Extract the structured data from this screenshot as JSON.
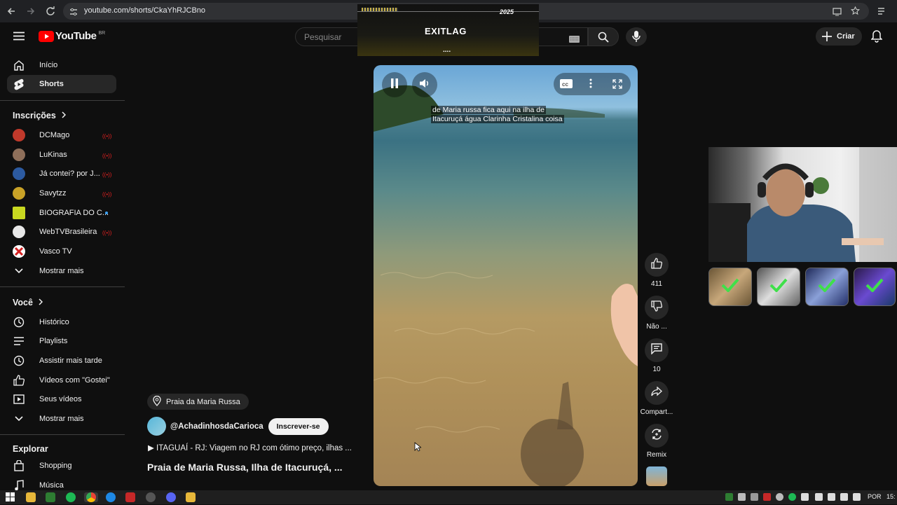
{
  "browser": {
    "url": "youtube.com/shorts/CkaYhRJCBno"
  },
  "header": {
    "logo_text": "YouTube",
    "region": "BR",
    "search_placeholder": "Pesquisar",
    "create_label": "Criar"
  },
  "ad_overlay": {
    "brand": "EXITLAG",
    "year": "2025",
    "dots": "...."
  },
  "sidebar": {
    "main": [
      {
        "label": "Início",
        "icon": "home-icon"
      },
      {
        "label": "Shorts",
        "icon": "shorts-icon"
      }
    ],
    "subscriptions_title": "Inscrições",
    "subscriptions": [
      {
        "label": "DCMago",
        "live": true,
        "color": "#c0392b"
      },
      {
        "label": "LuKinas",
        "live": true,
        "color": "#8e6f5a"
      },
      {
        "label": "Já contei? por J...",
        "live": true,
        "color": "#2c5aa0"
      },
      {
        "label": "Savytzz",
        "live": true,
        "color": "#c9a227"
      },
      {
        "label": "BIOGRAFIA DO C...",
        "live": false,
        "new": true,
        "color": "#c8d820"
      },
      {
        "label": "WebTVBrasileira",
        "live": true,
        "color": "#e8e8e8"
      },
      {
        "label": "Vasco TV",
        "live": false,
        "color": "#d42020"
      }
    ],
    "show_more_1": "Mostrar mais",
    "you_title": "Você",
    "you_items": [
      {
        "label": "Histórico",
        "icon": "history-icon"
      },
      {
        "label": "Playlists",
        "icon": "playlists-icon"
      },
      {
        "label": "Assistir mais tarde",
        "icon": "watch-later-icon"
      },
      {
        "label": "Vídeos com \"Gostei\"",
        "icon": "liked-icon"
      },
      {
        "label": "Seus vídeos",
        "icon": "your-videos-icon"
      }
    ],
    "show_more_2": "Mostrar mais",
    "explore_title": "Explorar",
    "explore_items": [
      {
        "label": "Shopping",
        "icon": "shopping-icon"
      },
      {
        "label": "Música",
        "icon": "music-icon"
      }
    ]
  },
  "video": {
    "caption_line1": "de Maria russa fica aqui na ilha de",
    "caption_line2": "Itacuruçá água Clarinha Cristalina coisa",
    "location": "Praia da Maria Russa",
    "channel": "@AchadinhosdaCarioca",
    "subscribe_label": "Inscrever-se",
    "description": "▶ ITAGUAÍ - RJ: Viagem no RJ com ótimo preço, ilhas ...",
    "title": "Praia de Maria Russa, Ilha de Itacuruçá, ..."
  },
  "actions": {
    "like_count": "411",
    "dislike_label": "Não ...",
    "comments_count": "10",
    "share_label": "Compart...",
    "remix_label": "Remix"
  },
  "taskbar": {
    "language": "POR",
    "clock": "15:"
  }
}
